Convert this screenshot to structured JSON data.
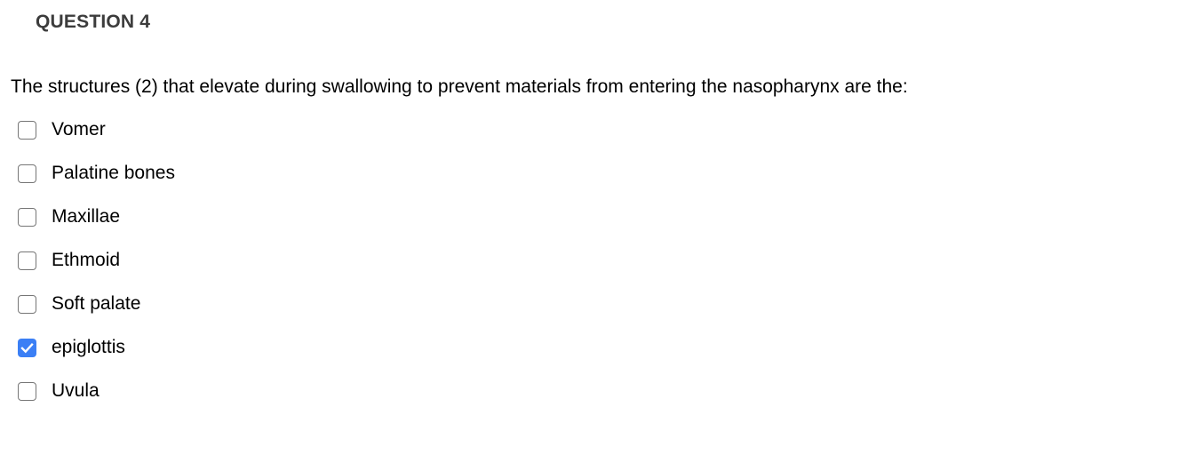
{
  "question": {
    "header": "QUESTION 4",
    "prompt": "The structures (2) that elevate during swallowing to prevent materials from entering the nasopharynx are the:",
    "type": "multiple-choice-checkbox",
    "options": [
      {
        "label": "Vomer",
        "checked": false
      },
      {
        "label": "Palatine bones",
        "checked": false
      },
      {
        "label": "Maxillae",
        "checked": false
      },
      {
        "label": "Ethmoid",
        "checked": false
      },
      {
        "label": "Soft palate",
        "checked": false
      },
      {
        "label": "epiglottis",
        "checked": true
      },
      {
        "label": "Uvula",
        "checked": false
      }
    ]
  },
  "colors": {
    "background": "#ffffff",
    "header_text": "#3c3c3c",
    "body_text": "#000000",
    "checkbox_border": "#767676",
    "checkbox_checked_fill": "#3b7ff5",
    "checkmark": "#ffffff"
  },
  "icons": {
    "checkmark": "check-icon",
    "checkbox_empty": "checkbox-unchecked-icon",
    "checkbox_filled": "checkbox-checked-icon"
  }
}
